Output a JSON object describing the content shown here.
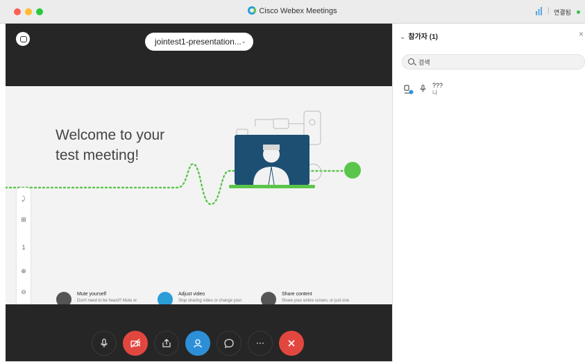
{
  "window": {
    "title": "Cisco Webex Meetings",
    "connection_label": "연결됨"
  },
  "stage": {
    "share_selector": "jointest1-presentation...",
    "slide": {
      "welcome_line1": "Welcome to your",
      "welcome_line2": "test meeting!",
      "tools": [
        "⤸",
        "⊞",
        "1",
        "⊕",
        "⊖",
        "⛶"
      ],
      "tips": [
        {
          "title": "Mute yourself",
          "body": "Don't need to be heard? Mute or unmute with one click.",
          "icon": "microphone-icon",
          "color": "#555555"
        },
        {
          "title": "Adjust video",
          "body": "Stop sharing video or change your camera device.",
          "icon": "video-camera-icon",
          "color": "#2b9ed8"
        },
        {
          "title": "Share content",
          "body": "Share your entire screen, or just one document or application.",
          "icon": "share-icon",
          "color": "#555555"
        }
      ]
    },
    "controls": [
      {
        "name": "mute-button",
        "icon": "microphone-icon"
      },
      {
        "name": "stop-video-button",
        "icon": "video-off-icon",
        "color": "#e2473f"
      },
      {
        "name": "share-button",
        "icon": "share-icon"
      },
      {
        "name": "participants-button",
        "icon": "participants-icon",
        "color": "#2e8fd9"
      },
      {
        "name": "chat-button",
        "icon": "chat-icon"
      },
      {
        "name": "more-options-button",
        "icon": "ellipsis-icon"
      },
      {
        "name": "leave-meeting-button",
        "icon": "close-icon",
        "color": "#e2473f"
      }
    ]
  },
  "panel": {
    "title": "참가자 (1)",
    "search_placeholder": "검색",
    "participants": [
      {
        "name": "???",
        "role": "나",
        "avatar_icon": "person-icon",
        "audio_icon": "microphone-icon"
      }
    ]
  },
  "colors": {
    "accent_green": "#5ac54b",
    "accent_blue": "#2e8fd9",
    "danger_red": "#e2473f",
    "stage_bg": "#262626"
  }
}
